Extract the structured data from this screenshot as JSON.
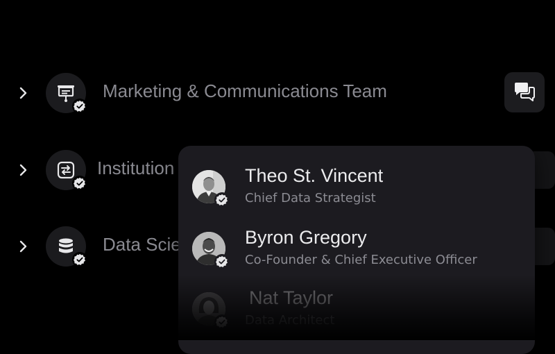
{
  "teams": [
    {
      "label": "Marketing & Communications Team",
      "icon": "presentation-board-icon",
      "verified": true
    },
    {
      "label": "Institution",
      "icon": "exchange-arrows-icon",
      "verified": true
    },
    {
      "label": "Data Scie",
      "icon": "database-icon",
      "verified": true
    }
  ],
  "members": [
    {
      "name": "Theo St. Vincent",
      "role": "Chief Data Strategist",
      "verified": true
    },
    {
      "name": "Byron Gregory",
      "role": "Co-Founder & Chief Executive Officer",
      "verified": true
    },
    {
      "name": "Nat Taylor",
      "role": "Data Architect",
      "verified": true
    }
  ],
  "colors": {
    "background": "#000000",
    "surface": "#1c1b20",
    "icon_circle": "#1b1b1e",
    "primary_text": "#ececee",
    "secondary_text": "#8a8a91"
  }
}
